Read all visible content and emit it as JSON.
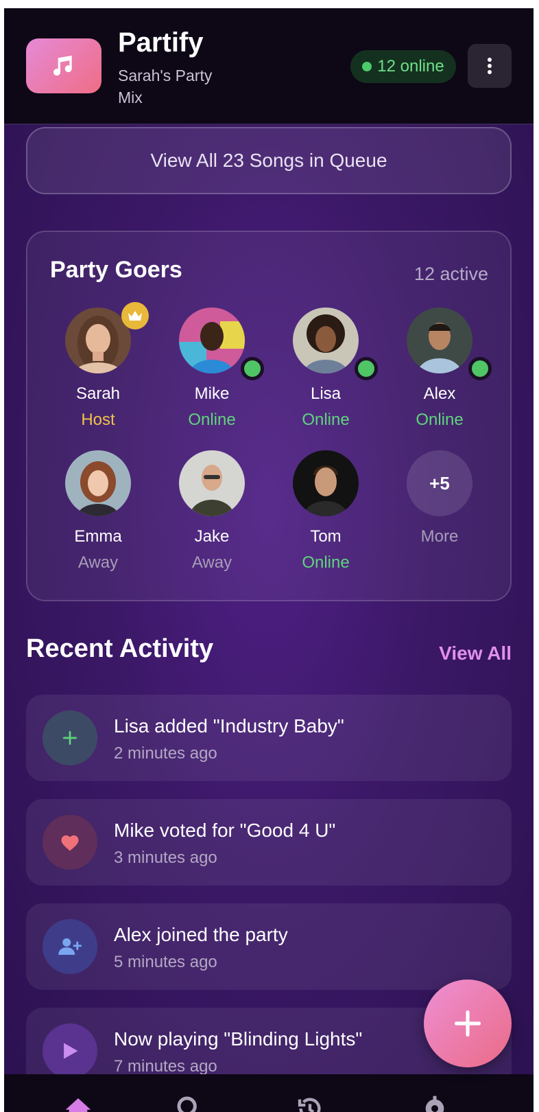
{
  "header": {
    "app_name": "Partify",
    "party_name": "Sarah's Party Mix",
    "online_label": "12 online"
  },
  "queue": {
    "button_label": "View All 23 Songs in Queue"
  },
  "party_goers": {
    "title": "Party Goers",
    "count_label": "12 active",
    "members": [
      {
        "name": "Sarah",
        "status": "Host"
      },
      {
        "name": "Mike",
        "status": "Online"
      },
      {
        "name": "Lisa",
        "status": "Online"
      },
      {
        "name": "Alex",
        "status": "Online"
      },
      {
        "name": "Emma",
        "status": "Away"
      },
      {
        "name": "Jake",
        "status": "Away"
      },
      {
        "name": "Tom",
        "status": "Online"
      }
    ],
    "more": {
      "count": "+5",
      "label": "More"
    }
  },
  "recent_activity": {
    "title": "Recent Activity",
    "view_all": "View All",
    "items": [
      {
        "text": "Lisa added \"Industry Baby\"",
        "time": "2 minutes ago",
        "icon": "plus-icon"
      },
      {
        "text": "Mike voted for \"Good 4 U\"",
        "time": "3 minutes ago",
        "icon": "heart-icon"
      },
      {
        "text": "Alex joined the party",
        "time": "5 minutes ago",
        "icon": "user-plus-icon"
      },
      {
        "text": "Now playing \"Blinding Lights\"",
        "time": "7 minutes ago",
        "icon": "play-icon"
      }
    ]
  },
  "bottom_nav": {
    "items": [
      {
        "icon": "home-icon",
        "active": true
      },
      {
        "icon": "search-icon",
        "active": false
      },
      {
        "icon": "history-icon",
        "active": false
      },
      {
        "icon": "gear-icon",
        "active": false
      }
    ]
  },
  "colors": {
    "accent": "#e290ea",
    "online": "#5fd47c",
    "host": "#f0c34a",
    "background": "#3b1866"
  }
}
